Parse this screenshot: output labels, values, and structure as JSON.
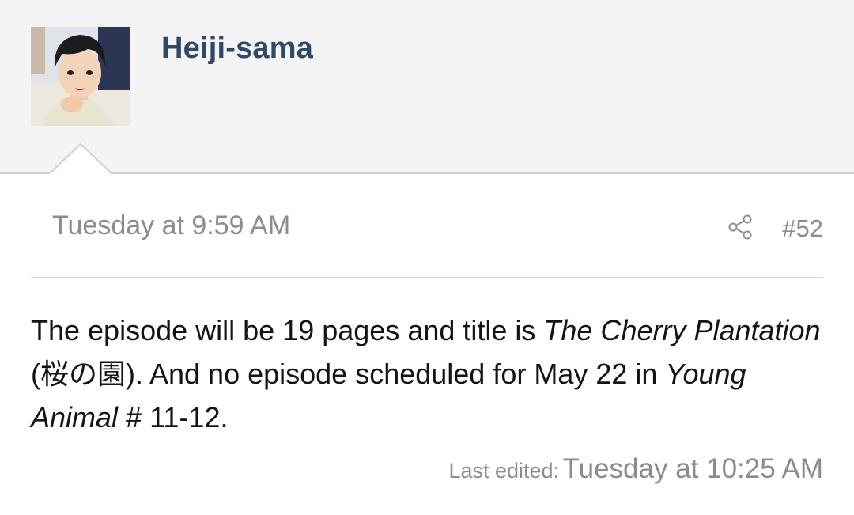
{
  "post": {
    "author": "Heiji-sama",
    "timestamp": "Tuesday at 9:59 AM",
    "post_number": "#52",
    "share_icon": "share-icon",
    "body": {
      "p1": "The episode will be 19 pages and title is ",
      "title_italic": "The Cherry Plantation",
      "p2": " (桜の園). And no episode scheduled for May 22 in ",
      "magazine_italic": "Young Animal",
      "p3": " # 11-12."
    },
    "last_edited_label": "Last edited:",
    "last_edited_time": "Tuesday at 10:25 AM"
  },
  "colors": {
    "header_bg": "#f4f4f4",
    "username": "#2f4968",
    "muted_text": "#8c8c8c",
    "body_text": "#141414"
  }
}
